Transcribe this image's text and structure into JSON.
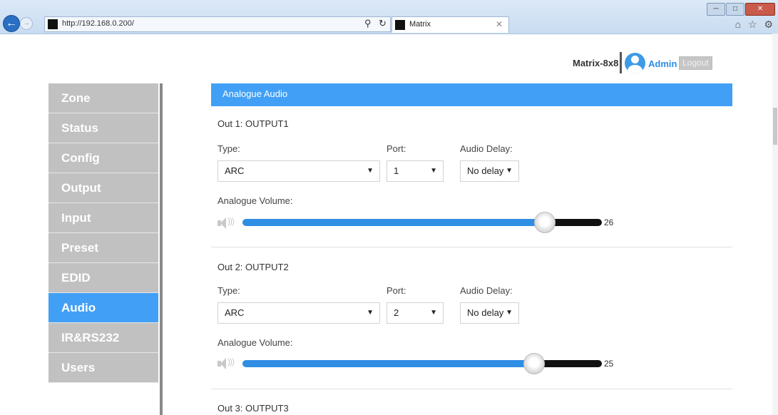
{
  "browser": {
    "url": "http://192.168.0.200/",
    "tab_title": "Matrix",
    "back_icon": "back-arrow-icon",
    "window_controls": [
      "─",
      "□",
      "✕"
    ],
    "toolbar_icons": "⌂ ☆ ⚙"
  },
  "header": {
    "device_name": "Matrix-8x8",
    "user": "Admin",
    "logout_label": "Logout"
  },
  "sidebar": {
    "items": [
      {
        "label": "Zone"
      },
      {
        "label": "Status"
      },
      {
        "label": "Config"
      },
      {
        "label": "Output"
      },
      {
        "label": "Input"
      },
      {
        "label": "Preset"
      },
      {
        "label": "EDID"
      },
      {
        "label": "Audio",
        "active": true
      },
      {
        "label": "IR&RS232"
      },
      {
        "label": "Users"
      }
    ]
  },
  "main": {
    "section_title": "Analogue Audio",
    "labels": {
      "type": "Type:",
      "port": "Port:",
      "audio_delay": "Audio Delay:",
      "analogue_volume": "Analogue Volume:"
    },
    "outputs": [
      {
        "title": "Out 1: OUTPUT1",
        "type": "ARC",
        "port": "1",
        "delay": "No delay",
        "volume": "26",
        "volume_fraction": 0.84
      },
      {
        "title": "Out 2: OUTPUT2",
        "type": "ARC",
        "port": "2",
        "delay": "No delay",
        "volume": "25",
        "volume_fraction": 0.81
      },
      {
        "title": "Out 3: OUTPUT3"
      }
    ]
  },
  "colors": {
    "accent": "#41a0f6",
    "sidebar_bg": "#c1c1c1",
    "slider_fill": "#2f8de4",
    "slider_track": "#111111"
  }
}
